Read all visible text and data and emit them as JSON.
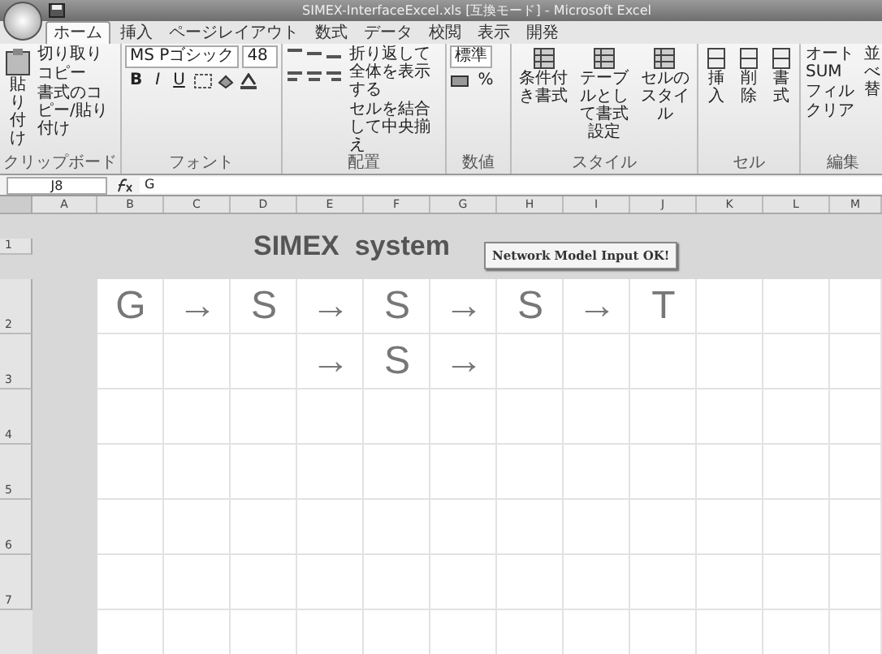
{
  "window": {
    "title": "SIMEX-InterfaceExcel.xls [互換モード] - Microsoft Excel"
  },
  "tabs": [
    {
      "label": "ホーム",
      "selected": true
    },
    {
      "label": "挿入",
      "selected": false
    },
    {
      "label": "ページレイアウト",
      "selected": false
    },
    {
      "label": "数式",
      "selected": false
    },
    {
      "label": "データ",
      "selected": false
    },
    {
      "label": "校閲",
      "selected": false
    },
    {
      "label": "表示",
      "selected": false
    },
    {
      "label": "開発",
      "selected": false
    }
  ],
  "ribbon": {
    "clipboard": {
      "paste": "貼り付け",
      "items": [
        "切り取り",
        "コピー",
        "書式のコピー/貼り付け"
      ],
      "label": "クリップボード"
    },
    "font": {
      "name": "MS Pゴシック",
      "size": "48",
      "styles": [
        "B",
        "I",
        "U"
      ],
      "label": "フォント"
    },
    "alignment": {
      "wrap": "折り返して全体を表示する",
      "merge": "セルを結合して中央揃え",
      "label": "配置"
    },
    "number": {
      "format": "標準",
      "percent": "%",
      "label": "数値"
    },
    "styles": {
      "buttons": [
        "条件付き書式",
        "テーブルとして書式設定",
        "セルのスタイル"
      ],
      "label": "スタイル"
    },
    "cells": {
      "buttons": [
        "挿入",
        "削除",
        "書式"
      ],
      "label": "セル"
    },
    "editing": {
      "items": [
        "オート SUM",
        "フィル",
        "クリア"
      ],
      "sort": "並べ替",
      "label": "編集"
    }
  },
  "formula_bar": {
    "name_box": "J8",
    "value": "G"
  },
  "sheet": {
    "columns": [
      "A",
      "B",
      "C",
      "D",
      "E",
      "F",
      "G",
      "H",
      "I",
      "J",
      "K",
      "L",
      "M"
    ],
    "rows": [
      {
        "number": "1",
        "kind": "title",
        "title": "SIMEX  system",
        "button": "Network Model Input OK!"
      },
      {
        "number": "2",
        "kind": "cells",
        "cells": [
          "G",
          "→",
          "S",
          "→",
          "S",
          "→",
          "S",
          "→",
          "T",
          null,
          null,
          null
        ]
      },
      {
        "number": "3",
        "kind": "cells",
        "cells": [
          null,
          null,
          null,
          "→",
          "S",
          "→",
          null,
          null,
          null,
          null,
          null,
          null
        ]
      },
      {
        "number": "4",
        "kind": "empty"
      },
      {
        "number": "5",
        "kind": "empty"
      },
      {
        "number": "6",
        "kind": "empty"
      },
      {
        "number": "7",
        "kind": "empty"
      }
    ]
  }
}
